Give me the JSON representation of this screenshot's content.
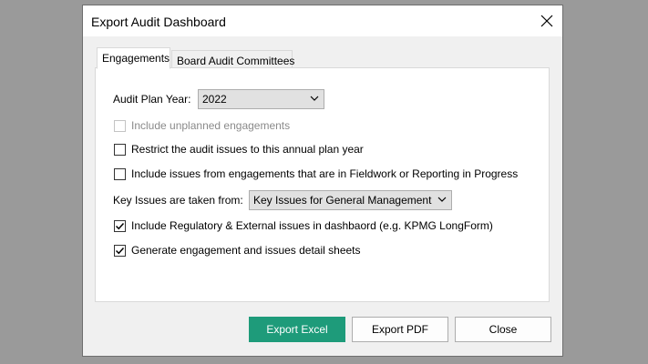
{
  "dialog": {
    "title": "Export Audit Dashboard",
    "close_icon": "close-icon"
  },
  "tabs": [
    {
      "label": "Engagements",
      "active": true
    },
    {
      "label": "Board Audit Committees",
      "active": false
    }
  ],
  "form": {
    "plan_year_label": "Audit Plan Year:",
    "plan_year_value": "2022",
    "key_issues_label": "Key Issues are taken from:",
    "key_issues_value": "Key Issues for General Management"
  },
  "checkboxes": [
    {
      "label": "Include unplanned engagements",
      "checked": false,
      "enabled": false
    },
    {
      "label": "Restrict the audit issues to this annual plan year",
      "checked": false,
      "enabled": true
    },
    {
      "label": "Include issues from engagements that are in Fieldwork or Reporting in Progress",
      "checked": false,
      "enabled": true
    },
    {
      "label": "Include Regulatory & External issues in dashbaord (e.g. KPMG LongForm)",
      "checked": true,
      "enabled": true
    },
    {
      "label": "Generate engagement and issues detail sheets",
      "checked": true,
      "enabled": true
    }
  ],
  "buttons": {
    "export_excel": "Export Excel",
    "export_pdf": "Export PDF",
    "close": "Close"
  },
  "colors": {
    "primary_button": "#1e9b7a"
  }
}
